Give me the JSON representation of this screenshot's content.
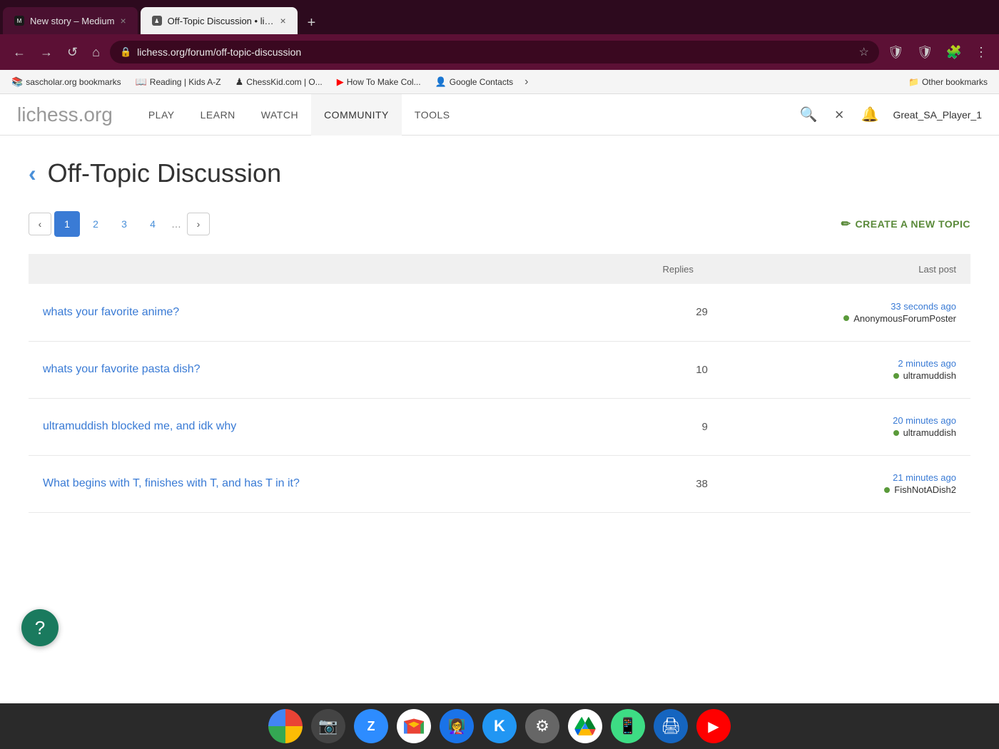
{
  "browser": {
    "tabs": [
      {
        "id": "tab1",
        "favicon_color": "#1a1a1a",
        "title": "New story – Medium",
        "active": false,
        "close_label": "×"
      },
      {
        "id": "tab2",
        "favicon_color": "#444",
        "title": "Off-Topic Discussion • lichess...",
        "active": true,
        "close_label": "×"
      }
    ],
    "tab_add_label": "+",
    "nav": {
      "back_label": "←",
      "forward_label": "→",
      "reload_label": "↺",
      "home_label": "⌂",
      "url": "lichess.org/forum/off-topic-discussion",
      "star_label": "☆",
      "shield1_label": "🛡",
      "shield2_label": "🛡",
      "puzzle_label": "🧩",
      "more_label": "⋮"
    },
    "bookmarks": [
      {
        "id": "bk1",
        "label": "sascholar.org bookmarks",
        "icon_class": "bk-sascholar",
        "icon_char": "📚"
      },
      {
        "id": "bk2",
        "label": "Reading | Kids A-Z",
        "icon_class": "bk-reading",
        "icon_char": "📖"
      },
      {
        "id": "bk3",
        "label": "ChessKid.com | O...",
        "icon_class": "bk-chesskid",
        "icon_char": "♟"
      },
      {
        "id": "bk4",
        "label": "How To Make Col...",
        "icon_class": "bk-youtube",
        "icon_char": "▶"
      },
      {
        "id": "bk5",
        "label": "Google Contacts",
        "icon_class": "bk-google",
        "icon_char": "👤"
      }
    ],
    "bookmarks_more_label": "›",
    "other_bookmarks_label": "Other bookmarks"
  },
  "lichess": {
    "logo_main": "lichess",
    "logo_ext": ".org",
    "nav_links": [
      {
        "id": "play",
        "label": "PLAY"
      },
      {
        "id": "learn",
        "label": "LEARN"
      },
      {
        "id": "watch",
        "label": "WATCH"
      },
      {
        "id": "community",
        "label": "COMMUNITY",
        "active": true
      },
      {
        "id": "tools",
        "label": "TOOLS"
      }
    ],
    "search_icon": "🔍",
    "close_icon": "×",
    "bell_icon": "🔔",
    "username": "Great_SA_Player_1",
    "forum": {
      "back_icon": "‹",
      "title": "Off-Topic Discussion",
      "pagination": {
        "prev_label": "‹",
        "next_label": "›",
        "pages": [
          "1",
          "2",
          "3",
          "4"
        ],
        "dots": "…",
        "active_page": "1"
      },
      "create_topic_icon": "✏",
      "create_topic_label": "CREATE A NEW TOPIC",
      "table_headers": {
        "topic": "",
        "replies": "Replies",
        "last_post": "Last post"
      },
      "topics": [
        {
          "id": "topic1",
          "title": "whats your favorite anime?",
          "replies": 29,
          "last_post_time": "33 seconds ago",
          "last_post_user": "AnonymousForumPoster",
          "user_online": true
        },
        {
          "id": "topic2",
          "title": "whats your favorite pasta dish?",
          "replies": 10,
          "last_post_time": "2 minutes ago",
          "last_post_user": "ultramuddish",
          "user_online": true
        },
        {
          "id": "topic3",
          "title": "ultramuddish blocked me, and idk why",
          "replies": 9,
          "last_post_time": "20 minutes ago",
          "last_post_user": "ultramuddish",
          "user_online": true
        },
        {
          "id": "topic4",
          "title": "What begins with T, finishes with T, and has T in it?",
          "replies": 38,
          "last_post_time": "21 minutes ago",
          "last_post_user": "FishNotADish2",
          "user_online": true
        }
      ]
    }
  },
  "taskbar": {
    "icons": [
      {
        "id": "chrome",
        "label": "C",
        "color": "#4285F4",
        "title": "Chrome"
      },
      {
        "id": "camera",
        "label": "📷",
        "color": "#444",
        "title": "Camera"
      },
      {
        "id": "zoom",
        "label": "Z",
        "color": "#2D8CFF",
        "title": "Zoom"
      },
      {
        "id": "gmail",
        "label": "M",
        "color": "#EA4335",
        "title": "Gmail"
      },
      {
        "id": "classroom",
        "label": "👩‍🏫",
        "color": "#1A73E8",
        "title": "Classroom"
      },
      {
        "id": "klack",
        "label": "K",
        "color": "#2196F3",
        "title": "Klack"
      },
      {
        "id": "settings",
        "label": "⚙",
        "color": "#555",
        "title": "Settings"
      },
      {
        "id": "drive",
        "label": "△",
        "color": "#34A853",
        "title": "Drive"
      },
      {
        "id": "phone",
        "label": "📱",
        "color": "#3DDC84",
        "title": "Phone"
      },
      {
        "id": "printer",
        "label": "🖨",
        "color": "#1565C0",
        "title": "Printer"
      },
      {
        "id": "youtube",
        "label": "▶",
        "color": "#FF0000",
        "title": "YouTube"
      }
    ]
  },
  "floating_button": {
    "icon": "?"
  }
}
